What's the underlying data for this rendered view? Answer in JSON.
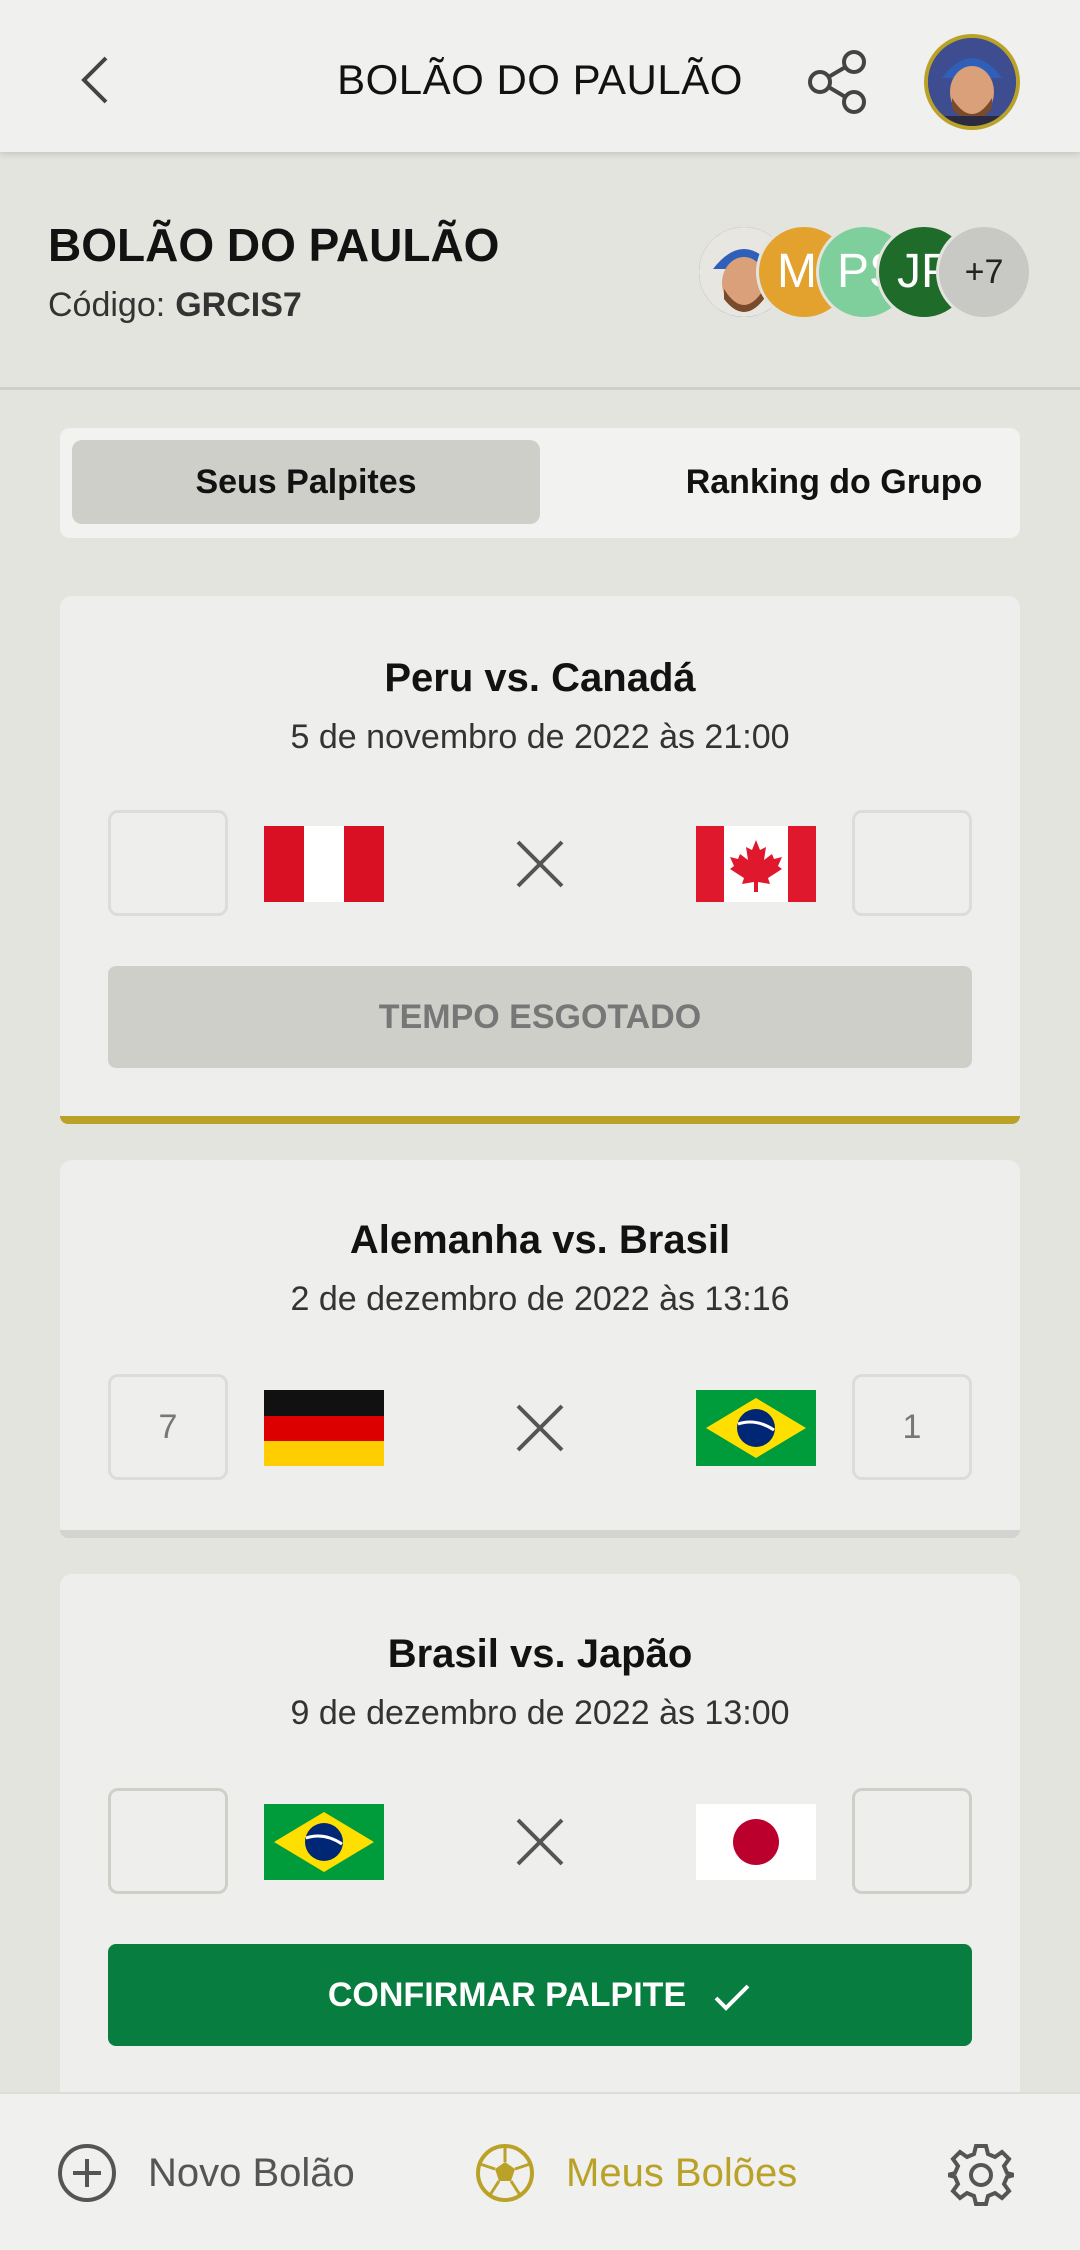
{
  "header": {
    "title": "BOLÃO DO PAULÃO"
  },
  "group": {
    "name": "BOLÃO DO PAULÃO",
    "code_label": "Código:",
    "code_value": "GRCIS7",
    "members": [
      {
        "initials": "",
        "color": "#3b4b8a",
        "avatar": true
      },
      {
        "initials": "MS",
        "color": "#e3a12d"
      },
      {
        "initials": "PS",
        "color": "#7fcf9c"
      },
      {
        "initials": "JP",
        "color": "#1e6b2a"
      }
    ],
    "more_members": "+7"
  },
  "tabs": {
    "active": "Seus Palpites",
    "inactive": "Ranking do Grupo"
  },
  "matches": [
    {
      "title": "Peru vs. Canadá",
      "date": "5 de novembro de 2022 às 21:00",
      "home_score": "",
      "away_score": "",
      "home_flag": "peru-flag",
      "away_flag": "canada-flag",
      "button": "TEMPO ESGOTADO",
      "bar_color": "#b9a227"
    },
    {
      "title": "Alemanha vs. Brasil",
      "date": "2 de dezembro de 2022 às 13:16",
      "home_score": "7",
      "away_score": "1",
      "home_flag": "germany-flag",
      "away_flag": "brazil-flag",
      "bar_color": "#d3d3cf"
    },
    {
      "title": "Brasil vs. Japão",
      "date": "9 de dezembro de 2022 às 13:00",
      "home_score": "",
      "away_score": "",
      "home_flag": "brazil-flag",
      "away_flag": "japan-flag",
      "button": "CONFIRMAR PALPITE"
    }
  ],
  "nav": {
    "new_pool": "Novo Bolão",
    "my_pools": "Meus Bolões",
    "accent_color": "#b9a227"
  }
}
